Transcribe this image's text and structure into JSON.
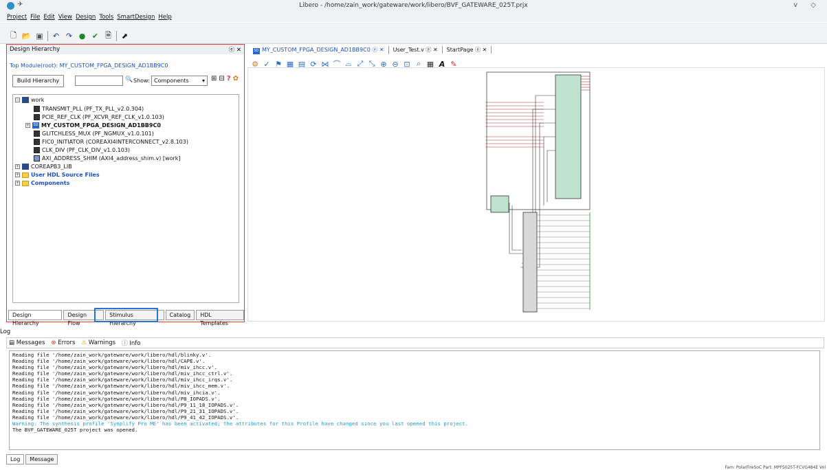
{
  "window": {
    "title": "Libero - /home/zain_work/gateware/work/libero/BVF_GATEWARE_025T.prjx",
    "controls": "v ◇"
  },
  "menu": [
    "Project",
    "File",
    "Edit",
    "View",
    "Design",
    "Tools",
    "SmartDesign",
    "Help"
  ],
  "left_panel": {
    "title": "Design Hierarchy",
    "top_module": "Top Module(root): MY_CUSTOM_FPGA_DESIGN_AD1BB9C0",
    "build_button": "Build Hierarchy",
    "show_label": "Show:",
    "show_value": "Components",
    "tree": [
      {
        "label": "work",
        "level": 0,
        "type": "lib",
        "toggle": "−"
      },
      {
        "label": "TRANSMIT_PLL (PF_TX_PLL_v2.0.304)",
        "level": 1,
        "type": "comp"
      },
      {
        "label": "PCIE_REF_CLK (PF_XCVR_REF_CLK_v1.0.103)",
        "level": 1,
        "type": "comp"
      },
      {
        "label": "MY_CUSTOM_FPGA_DESIGN_AD1BB9C0",
        "level": 1,
        "type": "sd",
        "toggle": "+",
        "bold": true
      },
      {
        "label": "GLITCHLESS_MUX (PF_NGMUX_v1.0.101)",
        "level": 1,
        "type": "comp"
      },
      {
        "label": "FIC0_INITIATOR (COREAXI4INTERCONNECT_v2.8.103)",
        "level": 1,
        "type": "comp"
      },
      {
        "label": "CLK_DIV (PF_CLK_DIV_v1.0.103)",
        "level": 1,
        "type": "comp"
      },
      {
        "label": "AXI_ADDRESS_SHIM (AXI4_address_shim.v) [work]",
        "level": 1,
        "type": "hdl"
      },
      {
        "label": "COREAPB3_LIB",
        "level": 0,
        "type": "lib",
        "toggle": "+"
      },
      {
        "label": "User HDL Source Files",
        "level": 0,
        "type": "folder",
        "toggle": "+",
        "blue": true
      },
      {
        "label": "Components",
        "level": 0,
        "type": "folder",
        "toggle": "+",
        "blue": true
      }
    ],
    "tabs": [
      "Design Hierarchy",
      "Design Flow",
      "Stimulus Hierarchy",
      "Catalog",
      "HDL Templates"
    ]
  },
  "right_tabs": [
    {
      "label": "MY_CUSTOM_FPGA_DESIGN_AD1BB9C0",
      "active": true
    },
    {
      "label": "User_Test.v",
      "active": false
    },
    {
      "label": "StartPage",
      "active": false
    }
  ],
  "log": {
    "title": "Log",
    "filters": [
      "Messages",
      "Errors",
      "Warnings",
      "Info"
    ],
    "lines": [
      {
        "text": "Reading file '/home/zain_work/gateware/work/libero/hdl/blinky.v'.",
        "kind": "normal"
      },
      {
        "text": "Reading file '/home/zain_work/gateware/work/libero/hdl/CAPE.v'.",
        "kind": "normal"
      },
      {
        "text": "Reading file '/home/zain_work/gateware/work/libero/hdl/miv_ihcc.v'.",
        "kind": "normal"
      },
      {
        "text": "Reading file '/home/zain_work/gateware/work/libero/hdl/miv_ihcc_ctrl.v'.",
        "kind": "normal"
      },
      {
        "text": "Reading file '/home/zain_work/gateware/work/libero/hdl/miv_ihcc_irqs.v'.",
        "kind": "normal"
      },
      {
        "text": "Reading file '/home/zain_work/gateware/work/libero/hdl/miv_ihcc_mem.v'.",
        "kind": "normal"
      },
      {
        "text": "Reading file '/home/zain_work/gateware/work/libero/hdl/miv_ihcia.v'.",
        "kind": "normal"
      },
      {
        "text": "Reading file '/home/zain_work/gateware/work/libero/hdl/P8_IOPADS.v'.",
        "kind": "normal"
      },
      {
        "text": "Reading file '/home/zain_work/gateware/work/libero/hdl/P9_11_18_IOPADS.v'.",
        "kind": "normal"
      },
      {
        "text": "Reading file '/home/zain_work/gateware/work/libero/hdl/P9_21_31_IOPADS.v'.",
        "kind": "normal"
      },
      {
        "text": "Reading file '/home/zain_work/gateware/work/libero/hdl/P9_41_42_IOPADS.v'.",
        "kind": "normal"
      },
      {
        "text": "Warning: The synthesis profile 'Synplify Pro ME' has been activated; the attributes for this Profile have changed since you last opened this project.",
        "kind": "warn"
      },
      {
        "text": "The BVF_GATEWARE_025T project was opened.",
        "kind": "normal"
      }
    ],
    "tabs": [
      "Log",
      "Message"
    ]
  },
  "status_right": "Fam: PolarFireSoC  Part: MPFS025T-FCVG484E  Vol"
}
